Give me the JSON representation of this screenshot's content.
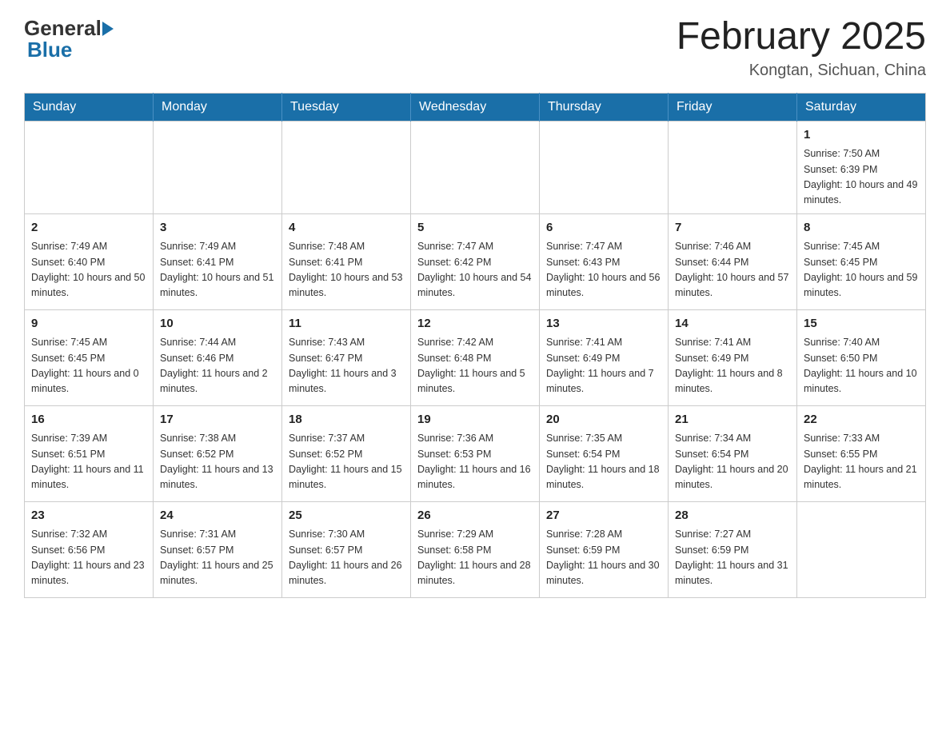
{
  "header": {
    "logo_general": "General",
    "logo_blue": "Blue",
    "month_title": "February 2025",
    "location": "Kongtan, Sichuan, China"
  },
  "calendar": {
    "days_of_week": [
      "Sunday",
      "Monday",
      "Tuesday",
      "Wednesday",
      "Thursday",
      "Friday",
      "Saturday"
    ],
    "weeks": [
      [
        {
          "day": "",
          "info": ""
        },
        {
          "day": "",
          "info": ""
        },
        {
          "day": "",
          "info": ""
        },
        {
          "day": "",
          "info": ""
        },
        {
          "day": "",
          "info": ""
        },
        {
          "day": "",
          "info": ""
        },
        {
          "day": "1",
          "info": "Sunrise: 7:50 AM\nSunset: 6:39 PM\nDaylight: 10 hours and 49 minutes."
        }
      ],
      [
        {
          "day": "2",
          "info": "Sunrise: 7:49 AM\nSunset: 6:40 PM\nDaylight: 10 hours and 50 minutes."
        },
        {
          "day": "3",
          "info": "Sunrise: 7:49 AM\nSunset: 6:41 PM\nDaylight: 10 hours and 51 minutes."
        },
        {
          "day": "4",
          "info": "Sunrise: 7:48 AM\nSunset: 6:41 PM\nDaylight: 10 hours and 53 minutes."
        },
        {
          "day": "5",
          "info": "Sunrise: 7:47 AM\nSunset: 6:42 PM\nDaylight: 10 hours and 54 minutes."
        },
        {
          "day": "6",
          "info": "Sunrise: 7:47 AM\nSunset: 6:43 PM\nDaylight: 10 hours and 56 minutes."
        },
        {
          "day": "7",
          "info": "Sunrise: 7:46 AM\nSunset: 6:44 PM\nDaylight: 10 hours and 57 minutes."
        },
        {
          "day": "8",
          "info": "Sunrise: 7:45 AM\nSunset: 6:45 PM\nDaylight: 10 hours and 59 minutes."
        }
      ],
      [
        {
          "day": "9",
          "info": "Sunrise: 7:45 AM\nSunset: 6:45 PM\nDaylight: 11 hours and 0 minutes."
        },
        {
          "day": "10",
          "info": "Sunrise: 7:44 AM\nSunset: 6:46 PM\nDaylight: 11 hours and 2 minutes."
        },
        {
          "day": "11",
          "info": "Sunrise: 7:43 AM\nSunset: 6:47 PM\nDaylight: 11 hours and 3 minutes."
        },
        {
          "day": "12",
          "info": "Sunrise: 7:42 AM\nSunset: 6:48 PM\nDaylight: 11 hours and 5 minutes."
        },
        {
          "day": "13",
          "info": "Sunrise: 7:41 AM\nSunset: 6:49 PM\nDaylight: 11 hours and 7 minutes."
        },
        {
          "day": "14",
          "info": "Sunrise: 7:41 AM\nSunset: 6:49 PM\nDaylight: 11 hours and 8 minutes."
        },
        {
          "day": "15",
          "info": "Sunrise: 7:40 AM\nSunset: 6:50 PM\nDaylight: 11 hours and 10 minutes."
        }
      ],
      [
        {
          "day": "16",
          "info": "Sunrise: 7:39 AM\nSunset: 6:51 PM\nDaylight: 11 hours and 11 minutes."
        },
        {
          "day": "17",
          "info": "Sunrise: 7:38 AM\nSunset: 6:52 PM\nDaylight: 11 hours and 13 minutes."
        },
        {
          "day": "18",
          "info": "Sunrise: 7:37 AM\nSunset: 6:52 PM\nDaylight: 11 hours and 15 minutes."
        },
        {
          "day": "19",
          "info": "Sunrise: 7:36 AM\nSunset: 6:53 PM\nDaylight: 11 hours and 16 minutes."
        },
        {
          "day": "20",
          "info": "Sunrise: 7:35 AM\nSunset: 6:54 PM\nDaylight: 11 hours and 18 minutes."
        },
        {
          "day": "21",
          "info": "Sunrise: 7:34 AM\nSunset: 6:54 PM\nDaylight: 11 hours and 20 minutes."
        },
        {
          "day": "22",
          "info": "Sunrise: 7:33 AM\nSunset: 6:55 PM\nDaylight: 11 hours and 21 minutes."
        }
      ],
      [
        {
          "day": "23",
          "info": "Sunrise: 7:32 AM\nSunset: 6:56 PM\nDaylight: 11 hours and 23 minutes."
        },
        {
          "day": "24",
          "info": "Sunrise: 7:31 AM\nSunset: 6:57 PM\nDaylight: 11 hours and 25 minutes."
        },
        {
          "day": "25",
          "info": "Sunrise: 7:30 AM\nSunset: 6:57 PM\nDaylight: 11 hours and 26 minutes."
        },
        {
          "day": "26",
          "info": "Sunrise: 7:29 AM\nSunset: 6:58 PM\nDaylight: 11 hours and 28 minutes."
        },
        {
          "day": "27",
          "info": "Sunrise: 7:28 AM\nSunset: 6:59 PM\nDaylight: 11 hours and 30 minutes."
        },
        {
          "day": "28",
          "info": "Sunrise: 7:27 AM\nSunset: 6:59 PM\nDaylight: 11 hours and 31 minutes."
        },
        {
          "day": "",
          "info": ""
        }
      ]
    ]
  }
}
